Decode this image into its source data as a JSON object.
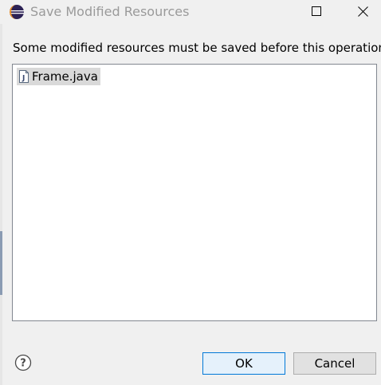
{
  "window": {
    "title": "Save Modified Resources"
  },
  "dialog": {
    "message": "Some modified resources must be saved before this operation.",
    "files": [
      {
        "name": "Frame.java",
        "icon": "java-file-icon",
        "selected": true
      }
    ]
  },
  "buttons": {
    "ok": "OK",
    "cancel": "Cancel",
    "help_icon": "help-icon"
  },
  "colors": {
    "title_text": "#9a9a9a",
    "dialog_bg": "#f0f0f0",
    "ok_border": "#0078d7",
    "selection_bg": "#d9d9d9"
  }
}
